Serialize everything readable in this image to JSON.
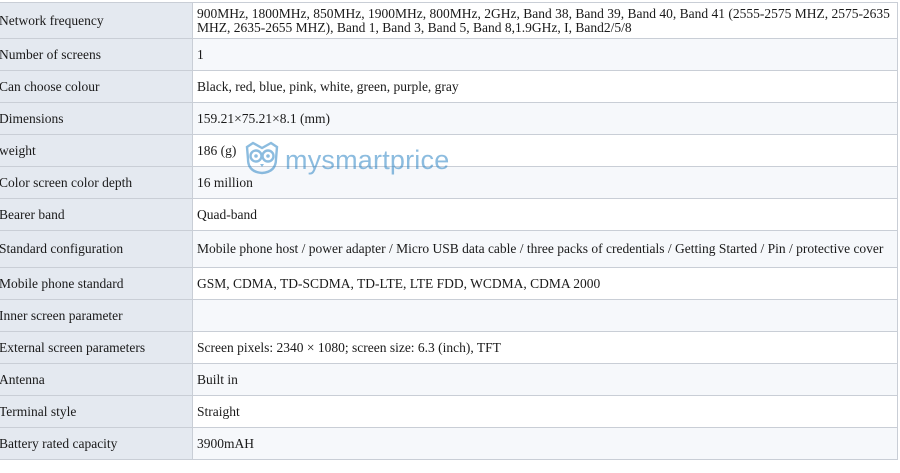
{
  "specs": [
    {
      "label": "Network frequency",
      "value": "900MHz, 1800MHz, 850MHz, 1900MHz, 800MHz, 2GHz, Band 38, Band 39, Band 40, Band 41 (2555-2575 MHZ, 2575-2635 MHZ, 2635-2655 MHZ), Band 1, Band 3, Band 5, Band 8,1.9GHz, I, Band2/5/8"
    },
    {
      "label": "Number of screens",
      "value": "1"
    },
    {
      "label": "Can choose colour",
      "value": "Black, red, blue, pink, white, green, purple, gray"
    },
    {
      "label": "Dimensions",
      "value": "159.21×75.21×8.1 (mm)"
    },
    {
      "label": "weight",
      "value": "186 (g)"
    },
    {
      "label": "Color screen color depth",
      "value": "16 million"
    },
    {
      "label": "Bearer band",
      "value": "Quad-band"
    },
    {
      "label": "Standard configuration",
      "value": "Mobile phone host / power adapter / Micro USB data cable / three packs of credentials / Getting Started / Pin / protective cover"
    },
    {
      "label": "Mobile phone standard",
      "value": "GSM, CDMA, TD-SCDMA, TD-LTE, LTE FDD, WCDMA, CDMA 2000"
    },
    {
      "label": "Inner screen parameter",
      "value": ""
    },
    {
      "label": "External screen parameters",
      "value": "Screen pixels: 2340 × 1080; screen size: 6.3 (inch), TFT"
    },
    {
      "label": "Antenna",
      "value": "Built in"
    },
    {
      "label": "Terminal style",
      "value": "Straight"
    },
    {
      "label": "Battery rated capacity",
      "value": "3900mAH"
    }
  ],
  "watermark": {
    "text": "mysmartprice",
    "color": "#2f86c6",
    "icon": "owl-logo-icon"
  }
}
